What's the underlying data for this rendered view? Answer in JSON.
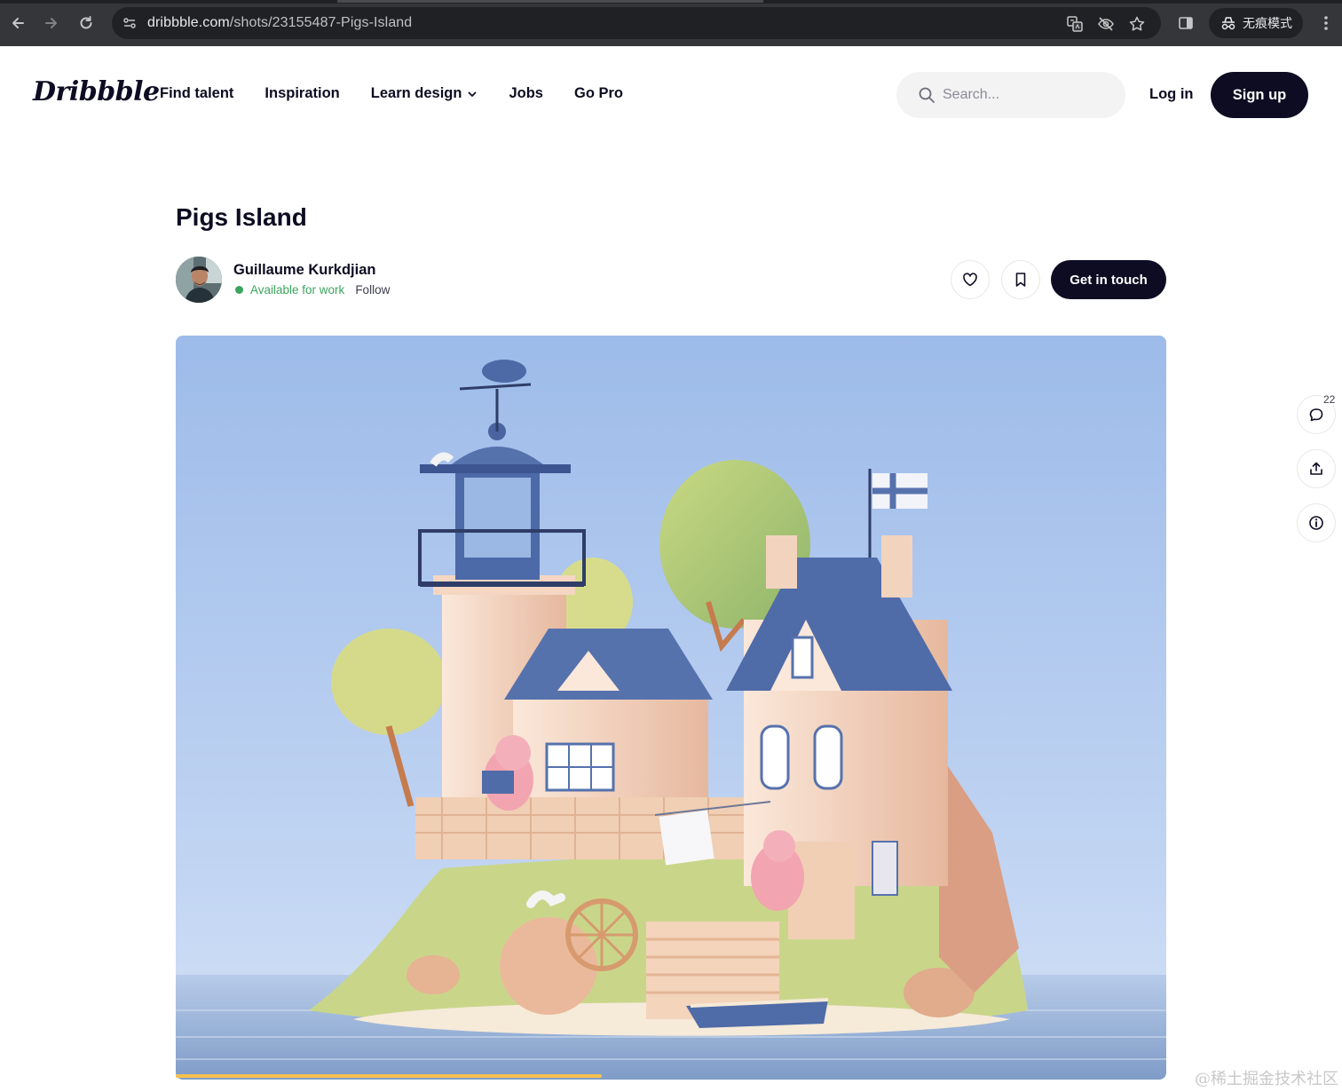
{
  "browser": {
    "url_domain": "dribbble.com",
    "url_path": "/shots/23155487-Pigs-Island",
    "incognito_label": "无痕模式"
  },
  "header": {
    "logo": "Dribbble",
    "nav": [
      "Find talent",
      "Inspiration",
      "Learn design",
      "Jobs",
      "Go Pro"
    ],
    "search_placeholder": "Search...",
    "login": "Log in",
    "signup": "Sign up"
  },
  "shot": {
    "title": "Pigs Island",
    "author": "Guillaume Kurkdjian",
    "availability": "Available for work",
    "follow": "Follow",
    "get_in_touch": "Get in touch",
    "comment_count": "22",
    "progress_fraction": 0.43
  },
  "colors": {
    "brand_dark": "#0d0c22",
    "available_green": "#3ba55d",
    "sky": "#a9c5f0",
    "roof_blue": "#5672ad"
  },
  "icons": {
    "like": "heart-icon",
    "save": "bookmark-icon",
    "comment": "comment-icon",
    "share": "share-icon",
    "info": "info-icon"
  },
  "watermark": "@稀土掘金技术社区"
}
